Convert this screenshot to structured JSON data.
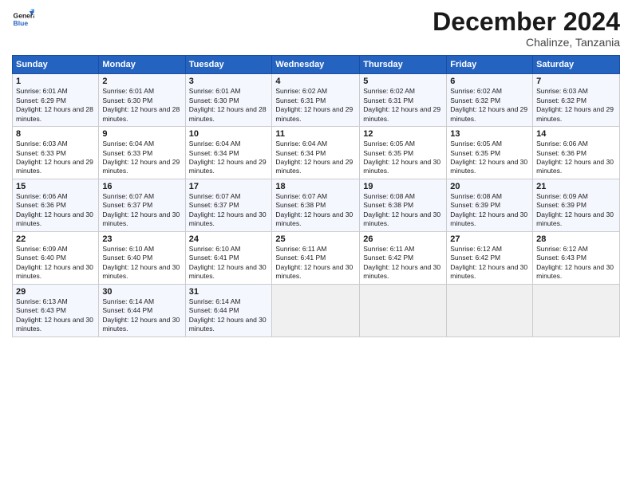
{
  "header": {
    "logo_general": "General",
    "logo_blue": "Blue",
    "month_title": "December 2024",
    "subtitle": "Chalinze, Tanzania"
  },
  "days_of_week": [
    "Sunday",
    "Monday",
    "Tuesday",
    "Wednesday",
    "Thursday",
    "Friday",
    "Saturday"
  ],
  "weeks": [
    [
      {
        "day": "1",
        "info": "Sunrise: 6:01 AM\nSunset: 6:29 PM\nDaylight: 12 hours and 28 minutes."
      },
      {
        "day": "2",
        "info": "Sunrise: 6:01 AM\nSunset: 6:30 PM\nDaylight: 12 hours and 28 minutes."
      },
      {
        "day": "3",
        "info": "Sunrise: 6:01 AM\nSunset: 6:30 PM\nDaylight: 12 hours and 28 minutes."
      },
      {
        "day": "4",
        "info": "Sunrise: 6:02 AM\nSunset: 6:31 PM\nDaylight: 12 hours and 29 minutes."
      },
      {
        "day": "5",
        "info": "Sunrise: 6:02 AM\nSunset: 6:31 PM\nDaylight: 12 hours and 29 minutes."
      },
      {
        "day": "6",
        "info": "Sunrise: 6:02 AM\nSunset: 6:32 PM\nDaylight: 12 hours and 29 minutes."
      },
      {
        "day": "7",
        "info": "Sunrise: 6:03 AM\nSunset: 6:32 PM\nDaylight: 12 hours and 29 minutes."
      }
    ],
    [
      {
        "day": "8",
        "info": "Sunrise: 6:03 AM\nSunset: 6:33 PM\nDaylight: 12 hours and 29 minutes."
      },
      {
        "day": "9",
        "info": "Sunrise: 6:04 AM\nSunset: 6:33 PM\nDaylight: 12 hours and 29 minutes."
      },
      {
        "day": "10",
        "info": "Sunrise: 6:04 AM\nSunset: 6:34 PM\nDaylight: 12 hours and 29 minutes."
      },
      {
        "day": "11",
        "info": "Sunrise: 6:04 AM\nSunset: 6:34 PM\nDaylight: 12 hours and 29 minutes."
      },
      {
        "day": "12",
        "info": "Sunrise: 6:05 AM\nSunset: 6:35 PM\nDaylight: 12 hours and 30 minutes."
      },
      {
        "day": "13",
        "info": "Sunrise: 6:05 AM\nSunset: 6:35 PM\nDaylight: 12 hours and 30 minutes."
      },
      {
        "day": "14",
        "info": "Sunrise: 6:06 AM\nSunset: 6:36 PM\nDaylight: 12 hours and 30 minutes."
      }
    ],
    [
      {
        "day": "15",
        "info": "Sunrise: 6:06 AM\nSunset: 6:36 PM\nDaylight: 12 hours and 30 minutes."
      },
      {
        "day": "16",
        "info": "Sunrise: 6:07 AM\nSunset: 6:37 PM\nDaylight: 12 hours and 30 minutes."
      },
      {
        "day": "17",
        "info": "Sunrise: 6:07 AM\nSunset: 6:37 PM\nDaylight: 12 hours and 30 minutes."
      },
      {
        "day": "18",
        "info": "Sunrise: 6:07 AM\nSunset: 6:38 PM\nDaylight: 12 hours and 30 minutes."
      },
      {
        "day": "19",
        "info": "Sunrise: 6:08 AM\nSunset: 6:38 PM\nDaylight: 12 hours and 30 minutes."
      },
      {
        "day": "20",
        "info": "Sunrise: 6:08 AM\nSunset: 6:39 PM\nDaylight: 12 hours and 30 minutes."
      },
      {
        "day": "21",
        "info": "Sunrise: 6:09 AM\nSunset: 6:39 PM\nDaylight: 12 hours and 30 minutes."
      }
    ],
    [
      {
        "day": "22",
        "info": "Sunrise: 6:09 AM\nSunset: 6:40 PM\nDaylight: 12 hours and 30 minutes."
      },
      {
        "day": "23",
        "info": "Sunrise: 6:10 AM\nSunset: 6:40 PM\nDaylight: 12 hours and 30 minutes."
      },
      {
        "day": "24",
        "info": "Sunrise: 6:10 AM\nSunset: 6:41 PM\nDaylight: 12 hours and 30 minutes."
      },
      {
        "day": "25",
        "info": "Sunrise: 6:11 AM\nSunset: 6:41 PM\nDaylight: 12 hours and 30 minutes."
      },
      {
        "day": "26",
        "info": "Sunrise: 6:11 AM\nSunset: 6:42 PM\nDaylight: 12 hours and 30 minutes."
      },
      {
        "day": "27",
        "info": "Sunrise: 6:12 AM\nSunset: 6:42 PM\nDaylight: 12 hours and 30 minutes."
      },
      {
        "day": "28",
        "info": "Sunrise: 6:12 AM\nSunset: 6:43 PM\nDaylight: 12 hours and 30 minutes."
      }
    ],
    [
      {
        "day": "29",
        "info": "Sunrise: 6:13 AM\nSunset: 6:43 PM\nDaylight: 12 hours and 30 minutes."
      },
      {
        "day": "30",
        "info": "Sunrise: 6:14 AM\nSunset: 6:44 PM\nDaylight: 12 hours and 30 minutes."
      },
      {
        "day": "31",
        "info": "Sunrise: 6:14 AM\nSunset: 6:44 PM\nDaylight: 12 hours and 30 minutes."
      },
      {
        "day": "",
        "info": ""
      },
      {
        "day": "",
        "info": ""
      },
      {
        "day": "",
        "info": ""
      },
      {
        "day": "",
        "info": ""
      }
    ]
  ]
}
